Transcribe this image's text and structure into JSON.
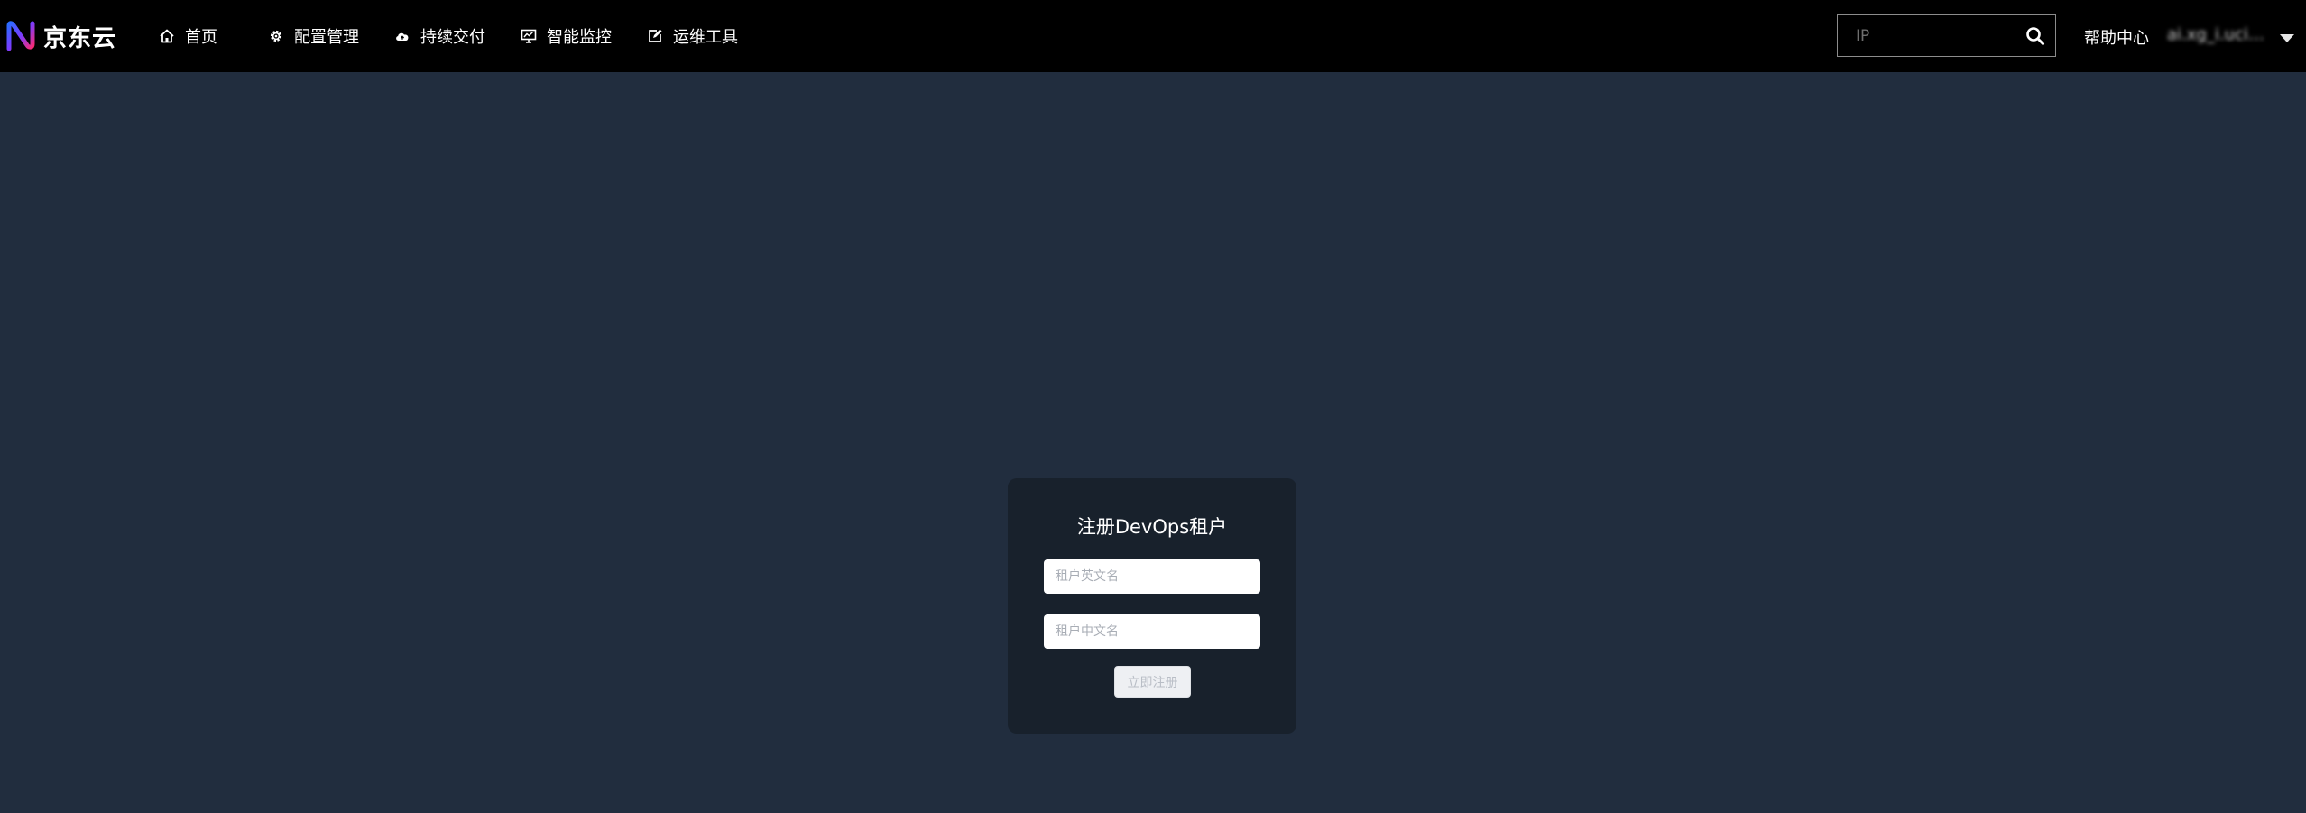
{
  "header": {
    "brand": "京东云",
    "nav": [
      {
        "label": "首页",
        "icon": "home-icon"
      },
      {
        "label": "配置管理",
        "icon": "gear-icon"
      },
      {
        "label": "持续交付",
        "icon": "cloud-upload-icon"
      },
      {
        "label": "智能监控",
        "icon": "monitor-icon"
      },
      {
        "label": "运维工具",
        "icon": "edit-box-icon"
      }
    ],
    "search": {
      "placeholder": "IP",
      "value": "",
      "icon": "search-icon"
    },
    "help_label": "帮助中心",
    "user_name": "ai.xg_i.ucixxu...",
    "user_menu_icon": "caret-down-icon"
  },
  "register": {
    "title": "注册DevOps租户",
    "en_name_placeholder": "租户英文名",
    "cn_name_placeholder": "租户中文名",
    "submit_label": "立即注册"
  },
  "colors": {
    "topbar": "#000000",
    "page_background": "#212d3e",
    "card_background": "#18212c"
  }
}
